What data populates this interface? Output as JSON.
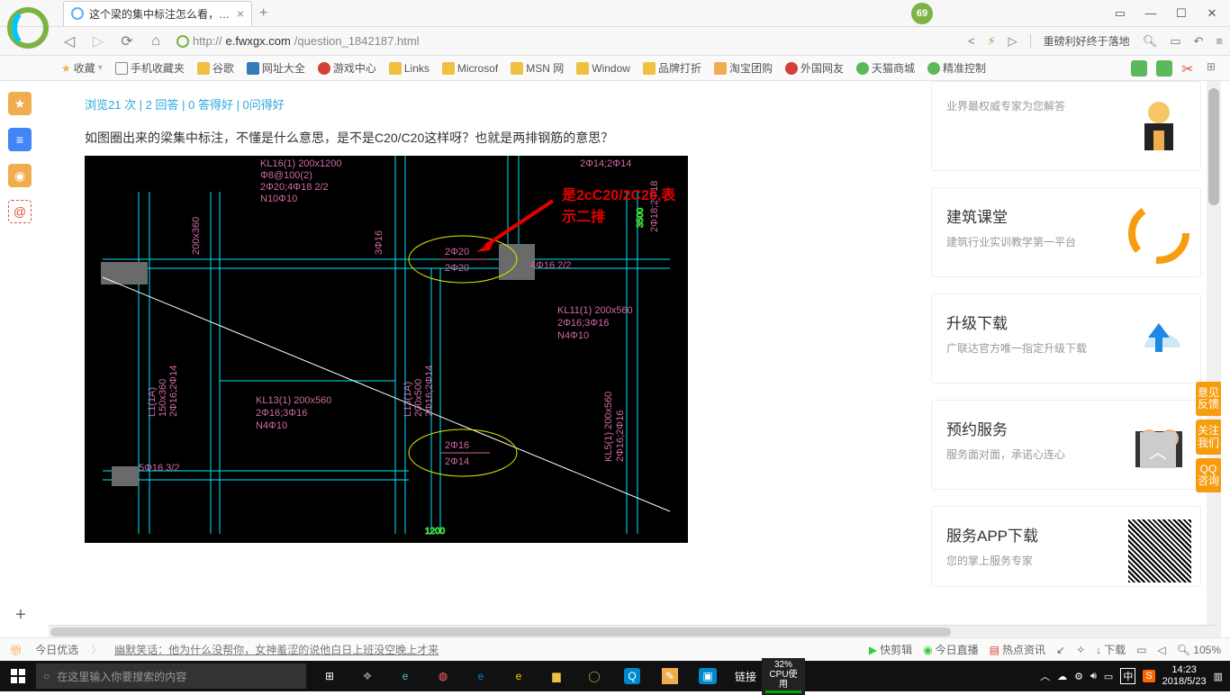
{
  "titlebar": {
    "tab_title": "这个梁的集中标注怎么看，是什...",
    "badge": "69"
  },
  "nav": {
    "url_prefix": "http://",
    "url_domain": "e.fwxgx.com",
    "url_path": "/question_1842187.html",
    "right_text": "重磅利好终于落地"
  },
  "bookmarks": {
    "fav": "收藏",
    "items": [
      "手机收藏夹",
      "谷歌",
      "网址大全",
      "游戏中心",
      "Links",
      "Microsof",
      "MSN 网",
      "Window",
      "品牌打折",
      "淘宝团购",
      "外国网友",
      "天猫商城",
      "精准控制"
    ]
  },
  "page": {
    "stats": "浏览21 次 | 2 回答 | 0 答得好 | 0问得好",
    "question": "如图圈出来的梁集中标注，不懂是什么意思，是不是C20/C20这样呀？也就是两排钢筋的意思？",
    "annotation": "是2cC20/2C20,表示二排"
  },
  "cad": {
    "labels": {
      "top1": "KL16(1) 200x1200",
      "top2": "Φ8@100(2)",
      "top3": "2Φ20;4Φ18 2/2",
      "top4": "N10Φ10",
      "t_dim1": "2Φ14;2Φ14",
      "c1a": "2Φ20",
      "c1b": "2Φ20",
      "mid": "4Φ16 2/2",
      "r1": "KL11(1) 200x560",
      "r2": "2Φ16;3Φ16",
      "r3": "N4Φ10",
      "l1": "KL13(1) 200x560",
      "l2": "2Φ16;3Φ16",
      "l3": "N4Φ10",
      "c2a": "2Φ16",
      "c2b": "2Φ14",
      "bl": "5Φ16 3/2",
      "v1": "L1(1A)",
      "v1b": "150x360",
      "v1c": "2Φ16;2Φ14",
      "v2": "L13(1A)",
      "v2b": "200x500",
      "v2c": "2Φ16;2Φ14",
      "v3": "KL5(1) 200x560",
      "v3b": "2Φ16;2Φ16",
      "v4": "200x360",
      "v4b": "3Φ16",
      "v5a": "2Φ18;2Φ18",
      "v5b": "3500",
      "dim_b": "1200"
    }
  },
  "cards": [
    {
      "title": "",
      "sub": "业界最权威专家为您解答"
    },
    {
      "title": "建筑课堂",
      "sub": "建筑行业实训教学第一平台"
    },
    {
      "title": "升级下载",
      "sub": "广联达官方唯一指定升级下载"
    },
    {
      "title": "预约服务",
      "sub": "服务面对面，承诺心连心"
    },
    {
      "title": "服务APP下载",
      "sub": "您的掌上服务专家"
    }
  ],
  "sidetabs": [
    "意见反馈",
    "关注我们",
    "QQ咨询"
  ],
  "bottom1": {
    "l1": "今日优选",
    "l2": "幽默笑话：他为什么没帮你，女神羞涩的说他白日上班没空晚上才来",
    "r": [
      "快剪辑",
      "今日直播",
      "热点资讯",
      "↙",
      "✧",
      "下载",
      "▭",
      "◁"
    ],
    "zoom": "105%"
  },
  "bottom2": {
    "cortana": "在这里输入你要搜索的内容",
    "link": "链接",
    "cpu_pct": "32%",
    "cpu_lbl": "CPU使用",
    "ime": "中",
    "time": "14:23",
    "date": "2018/5/23"
  }
}
